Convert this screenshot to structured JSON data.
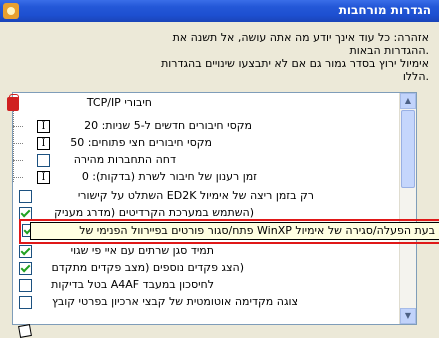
{
  "window": {
    "title": "הגדרות מורחבות"
  },
  "warning": {
    "line1": "אזהרה: כל עוד אינך יודע מה אתה עושה, אל תשנה את",
    "line2": ".ההגדרות הבאות",
    "line3": "אימיול ירוץ בסדר גמור גם אם לא יתבצעו שינויים בהגדרות",
    "line4": ".הללו"
  },
  "tree": {
    "group_label": "חיבורי TCP/IP",
    "items": [
      {
        "label": "מקסי חיבורים חדשים ל-5 שניות: 20",
        "control": "input",
        "checked": false
      },
      {
        "label": "מקסי חיבורים חצי פתוחים: 50",
        "control": "input",
        "checked": false
      },
      {
        "label": "דחה התחברות מהירה",
        "control": "checkbox",
        "checked": false
      },
      {
        "label": "זמן רענון של חיבור לשרת (בדקות): 0",
        "control": "input",
        "checked": false
      }
    ]
  },
  "options": [
    {
      "label": "רק בזמן ריצה של אימיול ED2K השתלט על קישורי",
      "checked": false
    },
    {
      "label": "(השתמש במערכת הקרדיטים (מדרג מעניק",
      "checked": true
    },
    {
      "label": "תמיד סגן שרתים עם איי פי שגוי",
      "checked": true
    },
    {
      "label": "(הצג פקדים נוספים (מצב פקדים מתקדם",
      "checked": true
    },
    {
      "label": "לחיסכון במעבד A4AF בטל בדיקות",
      "checked": false
    },
    {
      "label": "צוגה מקדימה אוטומטית של קבצי ארכיון בפרטי קובץ",
      "checked": false
    }
  ],
  "tooltip": {
    "text": "בעת הפעלה/סגירה של אימיול WinXP פתח/סגור פורטים בפיירוול הפנימי של"
  }
}
